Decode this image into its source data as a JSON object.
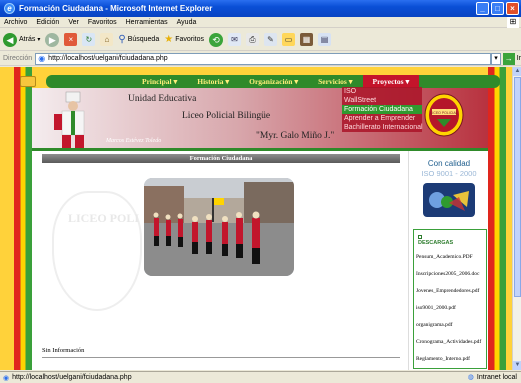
{
  "window": {
    "title": "Formación Ciudadana - Microsoft Internet Explorer"
  },
  "menubar": [
    "Archivo",
    "Edición",
    "Ver",
    "Favoritos",
    "Herramientas",
    "Ayuda"
  ],
  "toolbar": {
    "back_label": "Atrás",
    "search_label": "Búsqueda",
    "favorites_label": "Favoritos"
  },
  "address": {
    "label": "Dirección",
    "url": "http://localhost/uelgani/fciudadana.php",
    "go_label": "Ir"
  },
  "nav": {
    "items": [
      {
        "label": "Principal ▾"
      },
      {
        "label": "Historia ▾"
      },
      {
        "label": "Organización ▾"
      },
      {
        "label": "Servicios ▾"
      },
      {
        "label": "Proyectos ▾"
      }
    ]
  },
  "dropdown": {
    "items": [
      "ISO",
      "WallStreet",
      "Formación Ciudadana",
      "Aprender a Emprender",
      "Bachillerato Internacional"
    ],
    "highlighted_index": 2
  },
  "header": {
    "line1": "Unidad Educativa",
    "line2": "Liceo Policial Bilingüe",
    "line3": "\"Myr. Galo Miño J.\"",
    "caption": "Marcos Estévez Toledo",
    "crest_text": "LICEO POLICIAL"
  },
  "main": {
    "section_title": "Formación Ciudadana",
    "watermark": "LICEO POLI",
    "body_text": "Sin Información"
  },
  "sidebar": {
    "quality_line1": "Con calidad",
    "quality_line2": "ISO 9001 - 2000",
    "downloads_title": "DESCARGAS",
    "downloads": [
      "Pensum_Academico.PDF",
      "Inscripciones2005_2006.doc",
      "Jovenes_Emprendedores.pdf",
      "iso9001_2000.pdf",
      "organigrama.pdf",
      "Cronograma_Actividades.pdf",
      "Reglamento_Interno.pdf"
    ]
  },
  "status": {
    "url": "http://localhost/uelgani/fciudadana.php",
    "zone": "Intranet local"
  },
  "colors": {
    "nav_green": "#2f8a2a",
    "active_red": "#c4142b",
    "page_yellow": "#ffd23a"
  }
}
